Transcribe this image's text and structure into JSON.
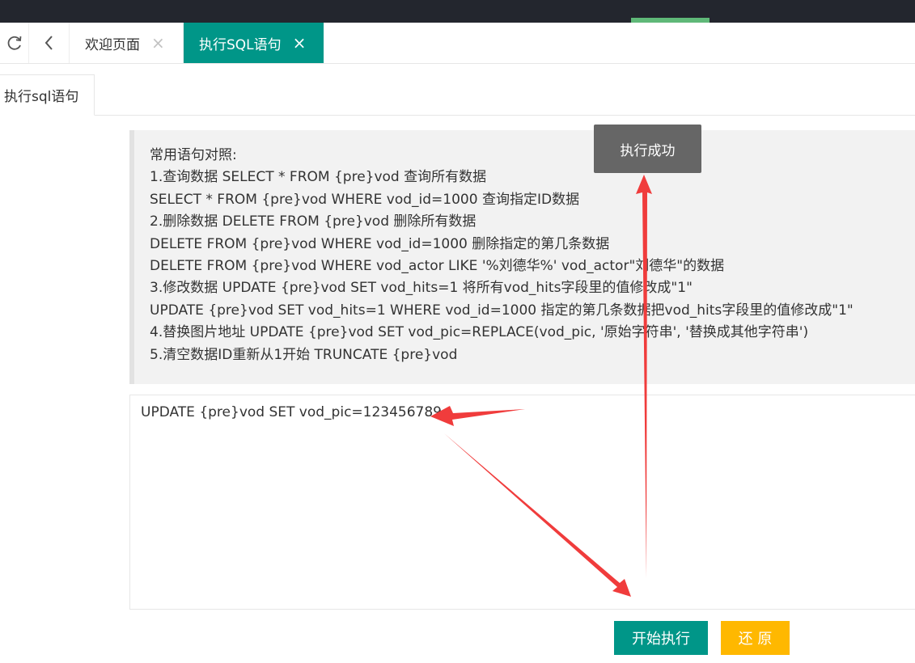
{
  "tabs": [
    {
      "label": "欢迎页面"
    },
    {
      "label": "执行SQL语句"
    }
  ],
  "subtab": {
    "label": "执行sql语句"
  },
  "tips": [
    "常用语句对照:",
    "1.查询数据 SELECT * FROM {pre}vod 查询所有数据",
    "SELECT * FROM {pre}vod WHERE vod_id=1000 查询指定ID数据",
    "2.删除数据 DELETE FROM {pre}vod 删除所有数据",
    "DELETE FROM {pre}vod WHERE vod_id=1000 删除指定的第几条数据",
    "DELETE FROM {pre}vod WHERE vod_actor LIKE '%刘德华%' vod_actor\"刘德华\"的数据",
    "3.修改数据 UPDATE {pre}vod SET vod_hits=1 将所有vod_hits字段里的值修改成\"1\"",
    "UPDATE {pre}vod SET vod_hits=1 WHERE vod_id=1000 指定的第几条数据把vod_hits字段里的值修改成\"1\"",
    "4.替换图片地址 UPDATE {pre}vod SET vod_pic=REPLACE(vod_pic, '原始字符串', '替换成其他字符串')",
    "5.清空数据ID重新从1开始 TRUNCATE {pre}vod"
  ],
  "editor": {
    "value": "UPDATE {pre}vod SET vod_pic=123456789"
  },
  "buttons": {
    "execute": "开始执行",
    "restore": "还 原"
  },
  "toast": {
    "message": "执行成功"
  },
  "colors": {
    "primary": "#009688",
    "warm": "#ffb800",
    "nav_dark": "#23262e",
    "nav_active": "#5fb878",
    "annotation_arrow": "#f03c3c"
  },
  "icons": {
    "refresh": "refresh-icon",
    "back": "chevron-left-icon",
    "close": "close-icon"
  }
}
